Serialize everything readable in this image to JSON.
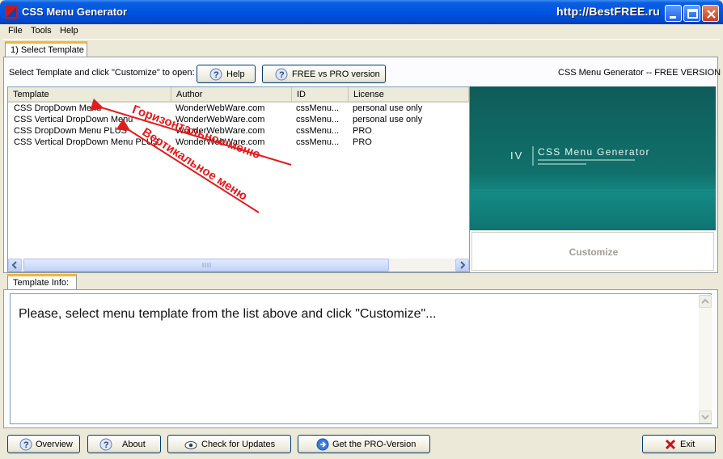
{
  "window": {
    "title": "CSS Menu Generator",
    "watermark": "http://BestFREE.ru"
  },
  "menubar": {
    "items": [
      "File",
      "Tools",
      "Help"
    ]
  },
  "tabs": {
    "select_template": "1) Select Template",
    "template_info": "Template Info:"
  },
  "toolbar": {
    "prompt": "Select Template and click \"Customize\" to open:",
    "help_label": "Help",
    "free_vs_pro_label": "FREE vs PRO version",
    "version_text": "CSS Menu Generator -- FREE VERSION"
  },
  "list": {
    "columns": [
      "Template",
      "Author",
      "ID",
      "License"
    ],
    "rows": [
      [
        "CSS DropDown Menu",
        "WonderWebWare.com",
        "cssMenu...",
        "personal use only"
      ],
      [
        "CSS Vertical DropDown Menu",
        "WonderWebWare.com",
        "cssMenu...",
        "personal use only"
      ],
      [
        "CSS DropDown Menu PLUS",
        "WonderWebWare.com",
        "cssMenu...",
        "PRO"
      ],
      [
        "CSS Vertical DropDown Menu PLUS",
        "WonderWebWare.com",
        "cssMenu...",
        "PRO"
      ]
    ]
  },
  "annotations": {
    "horizontal": "Горизонтальное меню",
    "vertical": "Вертикальное меню"
  },
  "preview": {
    "title": "CSS Menu Generator",
    "roman": "IV"
  },
  "customize_label": "Customize",
  "info_text": "Please, select menu template from the list above and click \"Customize\"...",
  "bottom_buttons": {
    "overview": "Overview",
    "about": "About",
    "check_updates": "Check for Updates",
    "get_pro": "Get the PRO-Version",
    "exit": "Exit"
  },
  "colors": {
    "titlebar": "#0054e3",
    "annotation": "#e21c1c",
    "preview": "#11706b",
    "tab_accent": "#f7b33a"
  }
}
